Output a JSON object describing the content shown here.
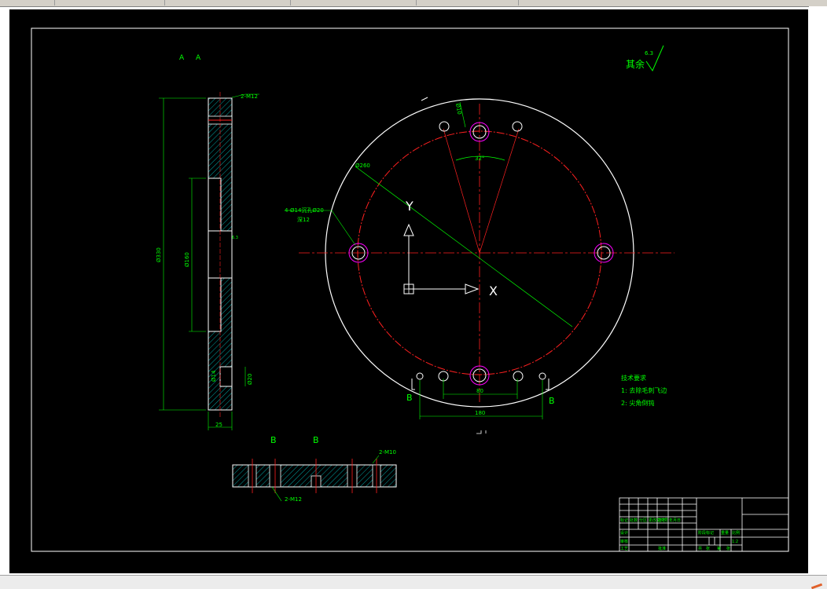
{
  "window": {
    "tabs": [
      "",
      "",
      "",
      "",
      ""
    ]
  },
  "drawing": {
    "section_aa": [
      "A",
      "A"
    ],
    "section_bb": [
      "B",
      "B"
    ],
    "finish_symbol": {
      "text": "其余",
      "value": "6.3"
    },
    "tech_requirements": {
      "title": "技术要求",
      "items": [
        "1: 去除毛刺飞边",
        "2: 尖角倒钝"
      ]
    },
    "dims": {
      "holes_2m12_top": "2-M12",
      "holes_2m12_bottom": "2-M12",
      "holes_2m10": "2-M10",
      "hole_spec_line1": "4-Ø14沉孔Ø20",
      "hole_spec_line2": "深12",
      "pcd": "Ø260",
      "angle": "32°",
      "spacing_80": "80",
      "spacing_180": "180",
      "overall_height": "Ø330",
      "inner_dia": "Ø160",
      "thickness": "25",
      "hole_depth": "Ø14",
      "cbore": "Ø20",
      "small_dim": "Ø10",
      "b_mark_left": "B",
      "b_mark_right": "B",
      "axis_x": "X",
      "axis_y": "Y",
      "rough_label": "6.3"
    },
    "title_block": {
      "row_labels": [
        "标记",
        "处数",
        "分区",
        "更改文件号",
        "签名",
        "年月日"
      ],
      "labels": [
        "设计",
        "审核",
        "工艺",
        "批准",
        "阶段标记",
        "重量",
        "比例"
      ],
      "footer": [
        "共",
        "张",
        "第",
        "张"
      ],
      "scale": "1:2"
    }
  }
}
